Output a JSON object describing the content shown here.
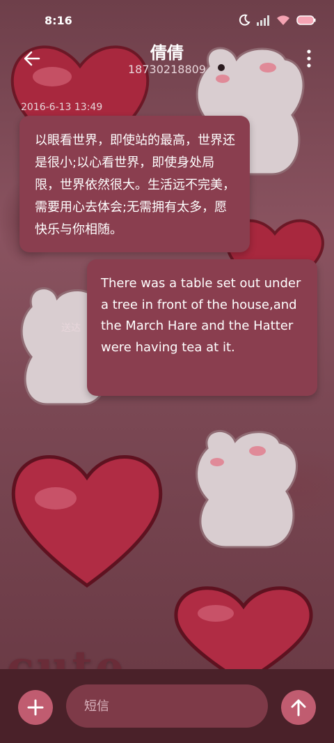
{
  "status_bar": {
    "time": "8:16",
    "icons": [
      "moon-icon",
      "signal-icon",
      "wifi-icon",
      "battery-icon"
    ]
  },
  "header": {
    "contact_name": "倩倩",
    "contact_number": "18730218809",
    "back_icon": "arrow-left-icon",
    "more_icon": "more-vertical-icon"
  },
  "conversation": {
    "timestamp": "2016-6-13 13:49",
    "messages": [
      {
        "direction": "incoming",
        "text": "以眼看世界，即使站的最高，世界还是很小;以心看世界，即使身处局限，世界依然很大。生活远不完美，需要用心去体会;无需拥有太多，愿快乐与你相随。"
      },
      {
        "direction": "outgoing",
        "text": "There was a table set out under a tree in front of the house,and the March Hare and the Hatter were having tea at it.",
        "status": "送达"
      }
    ]
  },
  "composer": {
    "placeholder": "短信",
    "value": "",
    "add_icon": "plus-icon",
    "send_icon": "arrow-up-icon"
  },
  "wallpaper": {
    "text": "cute"
  },
  "colors": {
    "bubble": "#8a3e4f",
    "input_bar": "#4a2129",
    "accent_button": "#c05c70",
    "input_field": "#7e3a48"
  }
}
